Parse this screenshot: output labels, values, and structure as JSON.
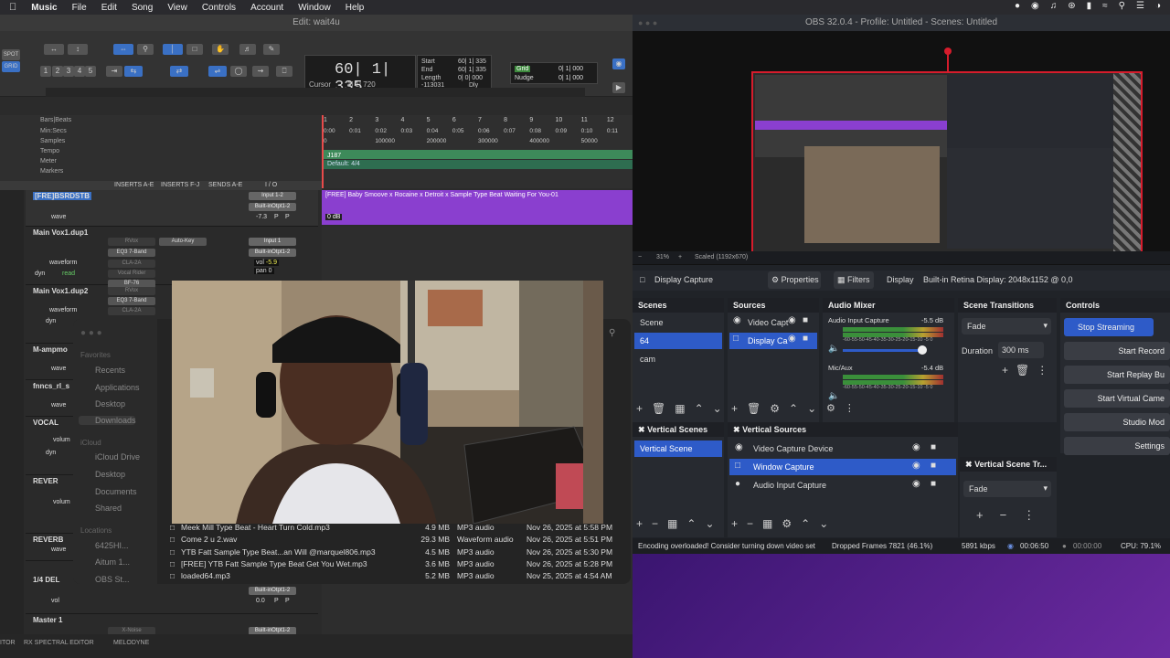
{
  "menubar": {
    "app": "Music",
    "items": [
      "File",
      "Edit",
      "Song",
      "View",
      "Controls",
      "Account",
      "Window",
      "Help"
    ]
  },
  "protools": {
    "title": "Edit: wait4u",
    "counter_main": "60| 1| 335",
    "cursor_label": "Cursor",
    "cursor_value": "1| 1| 720",
    "cursor_offset": "-113031",
    "sel_start_label": "Start",
    "sel_end_label": "End",
    "sel_length_label": "Length",
    "sel_start": "60| 1| 335",
    "sel_end": "60| 1| 335",
    "sel_length": "0| 0| 000",
    "grid_label": "Grid",
    "nudge_label": "Nudge",
    "grid_value": "0| 1| 000",
    "nudge_value": "0| 1| 000",
    "spot": "SPOT",
    "grid_mode": "GRID",
    "dly": "Dly",
    "rulers": [
      "Bars|Beats",
      "Min:Secs",
      "Samples",
      "Tempo",
      "Meter",
      "Markers"
    ],
    "bar_ticks": [
      "1",
      "2",
      "3",
      "4",
      "5",
      "6",
      "7",
      "8",
      "9",
      "10",
      "11",
      "12"
    ],
    "min_ticks": [
      "0:00",
      "0:01",
      "0:02",
      "0:03",
      "0:04",
      "0:05",
      "0:06",
      "0:07",
      "0:08",
      "0:09",
      "0:10",
      "0:11"
    ],
    "sample_ticks": [
      "0",
      "100000",
      "200000",
      "300000",
      "400000",
      "50000"
    ],
    "tempo": "J187",
    "meter": "Default: 4/4",
    "col_headers": [
      "INSERTS A-E",
      "INSERTS F-J",
      "SENDS A-E",
      "I / O"
    ],
    "tracks": [
      {
        "name": "[FRE]BSRDSTB",
        "in": "Input 1-2",
        "out": "Built-inOtpt1-2",
        "vol": "-7.3",
        "p1": "P",
        "p2": "P",
        "clip": "[FREE] Baby Smoove x Rocaine x Detroit x Sample Type Beat Waiting For You-01",
        "db": "0 dB",
        "view": "wave"
      },
      {
        "name": "Main Vox1.dup1",
        "in": "Input 1",
        "out": "Built-inOtpt1-2",
        "plugins": [
          "RVox",
          "EQ3 7-Band",
          "CLA-2A",
          "Vocal Rider",
          "BF-76"
        ],
        "auto": "Auto-Key",
        "vol_label": "vol",
        "vol": "-5.9",
        "pan_label": "pan",
        "pan": "0",
        "view": "waveform",
        "mode": "dyn",
        "read": "read"
      },
      {
        "name": "Main Vox1.dup2",
        "plugins": [
          "RVox",
          "EQ3 7-Band",
          "CLA-2A"
        ],
        "view": "waveform",
        "mode": "dyn"
      },
      {
        "name": "M-ampmo",
        "view": "wave"
      },
      {
        "name": "fnncs_rl_s",
        "view": "wave"
      },
      {
        "name": "VOCAL",
        "view": "volum",
        "mode": "dyn"
      },
      {
        "name": "REVER",
        "view": "volum"
      },
      {
        "name": "REVERB",
        "view": "wave"
      },
      {
        "name": "1/4 DEL",
        "vol": "0.0",
        "p1": "P",
        "p2": "P",
        "out": "Built-inOtpt1-2",
        "view": "vol"
      },
      {
        "name": "Master 1",
        "plugin": "X-Noise",
        "out": "Built-inOtpt1-2"
      }
    ],
    "bottom_items": [
      "ITOR",
      "RX SPECTRAL EDITOR",
      "MELODYNE"
    ]
  },
  "finder": {
    "sidebar_favorites": "Favorites",
    "favorites": [
      "Recents",
      "Applications",
      "Desktop",
      "Downloads"
    ],
    "sidebar_icloud": "iCloud",
    "icloud": [
      "iCloud Drive",
      "Desktop",
      "Documents",
      "Shared"
    ],
    "sidebar_locations": "Locations",
    "locations": [
      "6425HI...",
      "Aitum 1...",
      "OBS St..."
    ],
    "files": [
      {
        "name": "Meek Mill Type Beat - Heart Turn Cold.mp3",
        "size": "4.9 MB",
        "kind": "MP3 audio",
        "date": "Nov 26, 2025 at 5:58 PM"
      },
      {
        "name": "Come 2 u 2.wav",
        "size": "29.3 MB",
        "kind": "Waveform audio",
        "date": "Nov 26, 2025 at 5:51 PM"
      },
      {
        "name": "YTB Fatt Sample Type Beat...an Will  @marquel806.mp3",
        "size": "4.5 MB",
        "kind": "MP3 audio",
        "date": "Nov 26, 2025 at 5:30 PM"
      },
      {
        "name": "[FREE] YTB Fatt Sample Type Beat Get You Wet.mp3",
        "size": "3.6 MB",
        "kind": "MP3 audio",
        "date": "Nov 26, 2025 at 5:28 PM"
      },
      {
        "name": "loaded64.mp3",
        "size": "5.2 MB",
        "kind": "MP3 audio",
        "date": "Nov 25, 2025 at 4:54 AM"
      }
    ]
  },
  "obs": {
    "title": "OBS 32.0.4 - Profile: Untitled - Scenes: Untitled",
    "zoom": "31%",
    "scaled": "Scaled (1192x670)",
    "source_name": "Display Capture",
    "properties": "Properties",
    "filters": "Filters",
    "display_label": "Display",
    "display_value": "Built-in Retina Display: 2048x1152 @ 0,0",
    "scenes_title": "Scenes",
    "scenes": [
      "Scene",
      "64",
      "cam"
    ],
    "scene_selected": 1,
    "sources_title": "Sources",
    "sources": [
      "Video Capt",
      "Display Ca"
    ],
    "mixer_title": "Audio Mixer",
    "mixer": [
      {
        "name": "Audio Input Capture",
        "db": "-5.5 dB"
      },
      {
        "name": "Mic/Aux",
        "db": "-5.4 dB"
      }
    ],
    "mixer_scale": "-60-55-50-45-40-35-30-25-20-15-10 -5  0",
    "transitions_title": "Scene Transitions",
    "transition": "Fade",
    "duration_label": "Duration",
    "duration": "300 ms",
    "controls_title": "Controls",
    "controls": [
      "Stop Streaming",
      "Start Record",
      "Start Replay Bu",
      "Start Virtual Came",
      "Studio Mod",
      "Settings"
    ],
    "vscenes_title": "Vertical Scenes",
    "vscenes": [
      "Vertical Scene"
    ],
    "vsources_title": "Vertical Sources",
    "vsources": [
      "Video Capture Device",
      "Window Capture",
      "Audio Input Capture"
    ],
    "vtrans_title": "Vertical Scene Tr...",
    "vtransition": "Fade",
    "status_warning": "Encoding overloaded! Consider turning down video set",
    "dropped": "Dropped Frames 7821 (46.1%)",
    "kbps": "5891 kbps",
    "stream_time": "00:06:50",
    "rec_time": "00:00:00",
    "cpu": "CPU: 79.1%"
  },
  "colors": {
    "accent": "#2e5bc8",
    "clip": "#8a3fcf",
    "record": "#d61c2c",
    "desktop": "#4a1a7a"
  }
}
